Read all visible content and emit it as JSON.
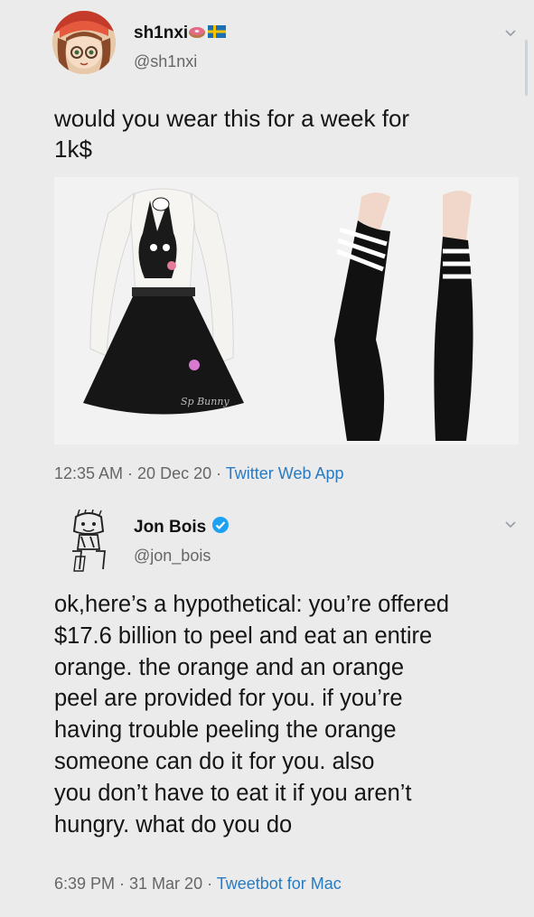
{
  "tweets": [
    {
      "display_name": "sh1nxi",
      "emoji": "🍩",
      "flag": "Sweden flag",
      "handle": "@sh1nxi",
      "text_lines": [
        "would you wear this for a week for",
        "1k$"
      ],
      "timestamp": "12:35 AM · 20 Dec 20 · ",
      "source": "Twitter Web App",
      "media": [
        "black and white bunny print dress",
        "black thigh high socks with white stripes"
      ]
    },
    {
      "display_name": "Jon Bois",
      "verified": true,
      "handle": "@jon_bois",
      "text_lines": [
        "ok,here’s a hypothetical: you’re offered",
        "$17.6 billion to peel and eat an entire",
        "orange. the orange and an orange",
        "peel are provided for you. if you’re",
        "having trouble peeling the orange",
        "someone can do it for you. also",
        "you don’t have to eat it if you aren’t",
        "hungry. what do you do"
      ],
      "timestamp": "6:39 PM · 31 Mar 20 · ",
      "source": "Tweetbot for Mac"
    }
  ],
  "colors": {
    "background": "#ebebeb",
    "link": "#2a7ac0",
    "verified": "#1da1f2",
    "muted": "#666666"
  }
}
